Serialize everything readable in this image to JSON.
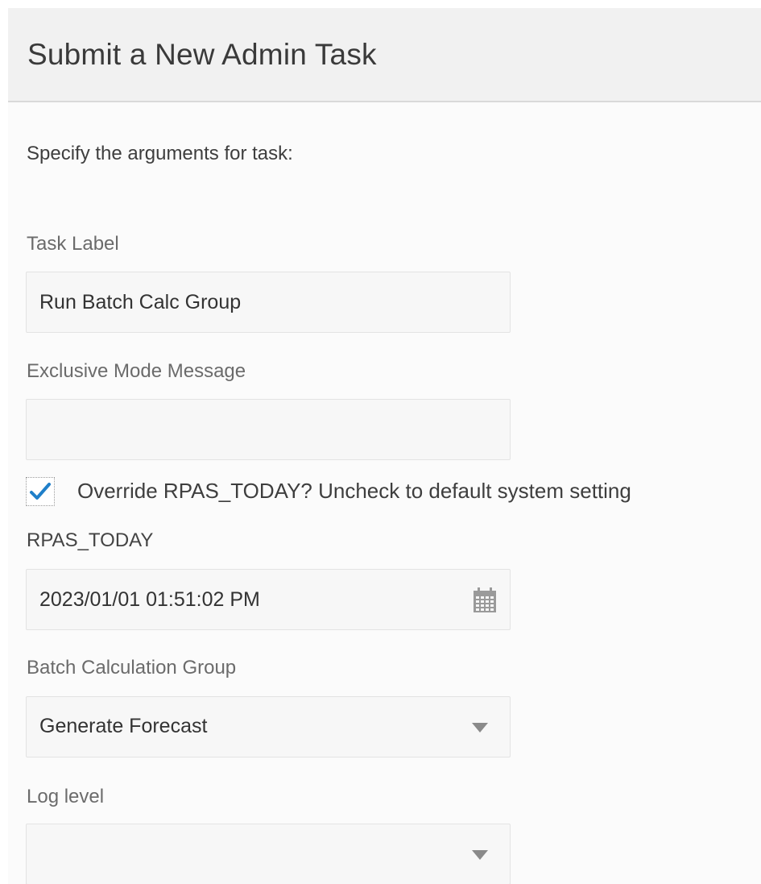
{
  "dialog": {
    "title": "Submit a New Admin Task"
  },
  "form": {
    "intro": "Specify the arguments for task:",
    "task_label": {
      "label": "Task Label",
      "value": "Run Batch Calc Group"
    },
    "exclusive_mode_message": {
      "label": "Exclusive Mode Message",
      "value": ""
    },
    "override_checkbox": {
      "label": "Override RPAS_TODAY? Uncheck to default system setting",
      "checked": true
    },
    "rpas_today": {
      "label": "RPAS_TODAY",
      "value": "2023/01/01 01:51:02 PM",
      "icon": "calendar-icon"
    },
    "batch_calculation_group": {
      "label": "Batch Calculation Group",
      "value": "Generate Forecast",
      "icon": "chevron-down-icon"
    },
    "log_level": {
      "label": "Log level",
      "value": "",
      "icon": "chevron-down-icon"
    }
  },
  "colors": {
    "header_bg": "#f1f1f1",
    "panel_bg": "#fbfbfb",
    "field_bg": "#f7f7f7",
    "check_accent": "#1f7fc9"
  }
}
